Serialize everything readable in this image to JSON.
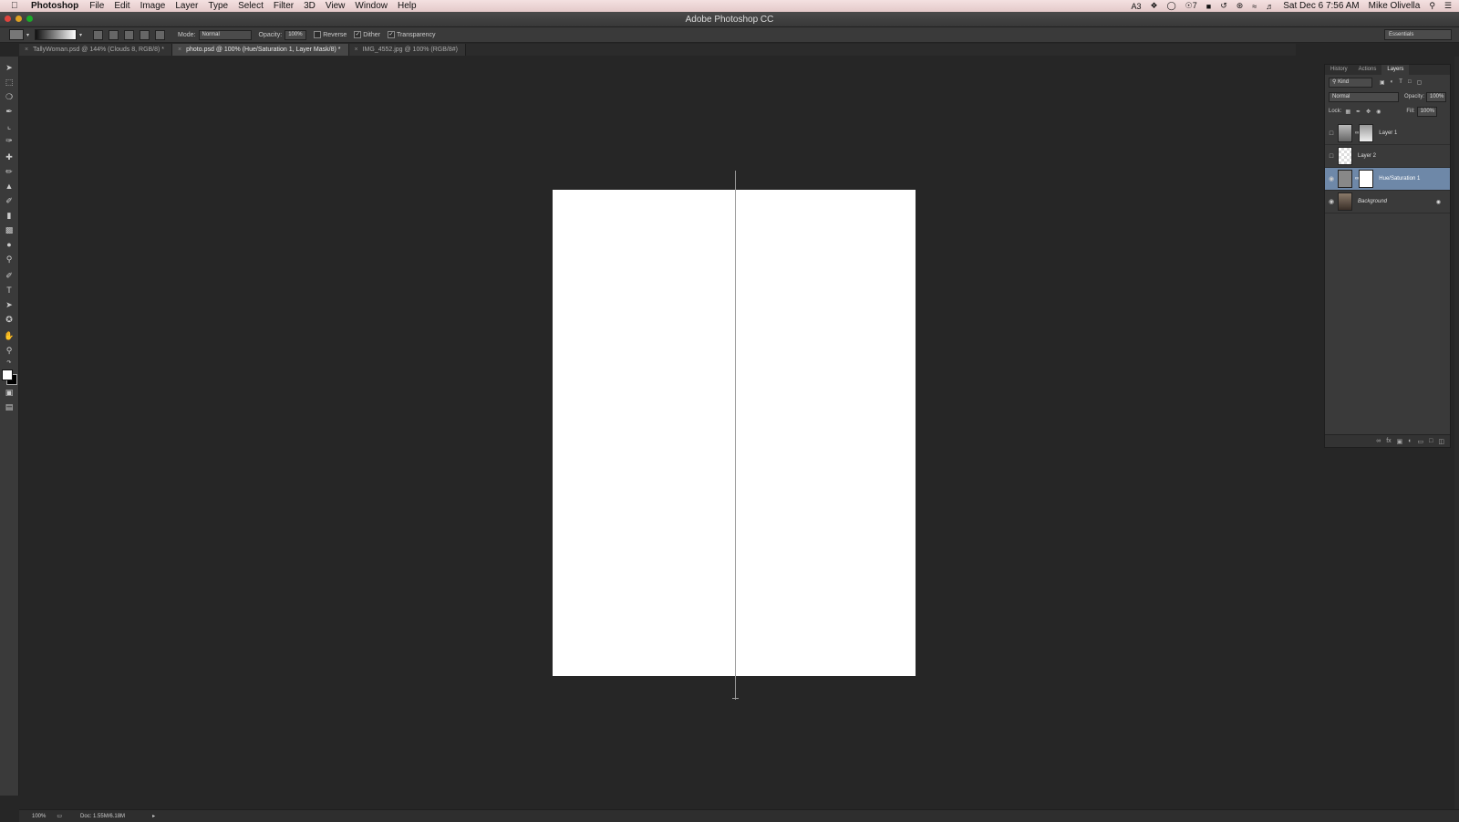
{
  "menubar": {
    "app_name": "Photoshop",
    "menus": [
      "File",
      "Edit",
      "Image",
      "Layer",
      "Type",
      "Select",
      "Filter",
      "3D",
      "View",
      "Window",
      "Help"
    ],
    "status_items": {
      "adobe_badge": "3",
      "notif_count": "7",
      "datetime": "Sat Dec 6  7:56 AM",
      "user": "Mike Olivella"
    }
  },
  "window": {
    "title": "Adobe Photoshop CC"
  },
  "options_bar": {
    "mode_label": "Mode:",
    "mode_value": "Normal",
    "opacity_label": "Opacity:",
    "opacity_value": "100%",
    "reverse_label": "Reverse",
    "dither_label": "Dither",
    "transparency_label": "Transparency",
    "workspace": "Essentials"
  },
  "tabs": [
    {
      "label": "TallyWoman.psd @ 144% (Clouds 8, RGB/8) *",
      "active": false
    },
    {
      "label": "photo.psd @ 100% (Hue/Saturation 1, Layer Mask/8) *",
      "active": true
    },
    {
      "label": "IMG_4552.jpg @ 100% (RGB/8#)",
      "active": false
    }
  ],
  "layers_panel": {
    "tabs": [
      "History",
      "Actions",
      "Layers"
    ],
    "filter_label": "Kind",
    "blend_mode": "Normal",
    "opacity_label": "Opacity:",
    "opacity_value": "100%",
    "lock_label": "Lock:",
    "fill_label": "Fill:",
    "fill_value": "100%",
    "layers": [
      {
        "name": "Layer 1",
        "visible": false,
        "selected": false
      },
      {
        "name": "Layer 2",
        "visible": false,
        "selected": false
      },
      {
        "name": "Hue/Saturation 1",
        "visible": true,
        "selected": true
      },
      {
        "name": "Background",
        "visible": true,
        "selected": false
      }
    ]
  },
  "status_bar": {
    "zoom": "100%",
    "doc_info": "Doc: 1.55M/6.18M"
  }
}
